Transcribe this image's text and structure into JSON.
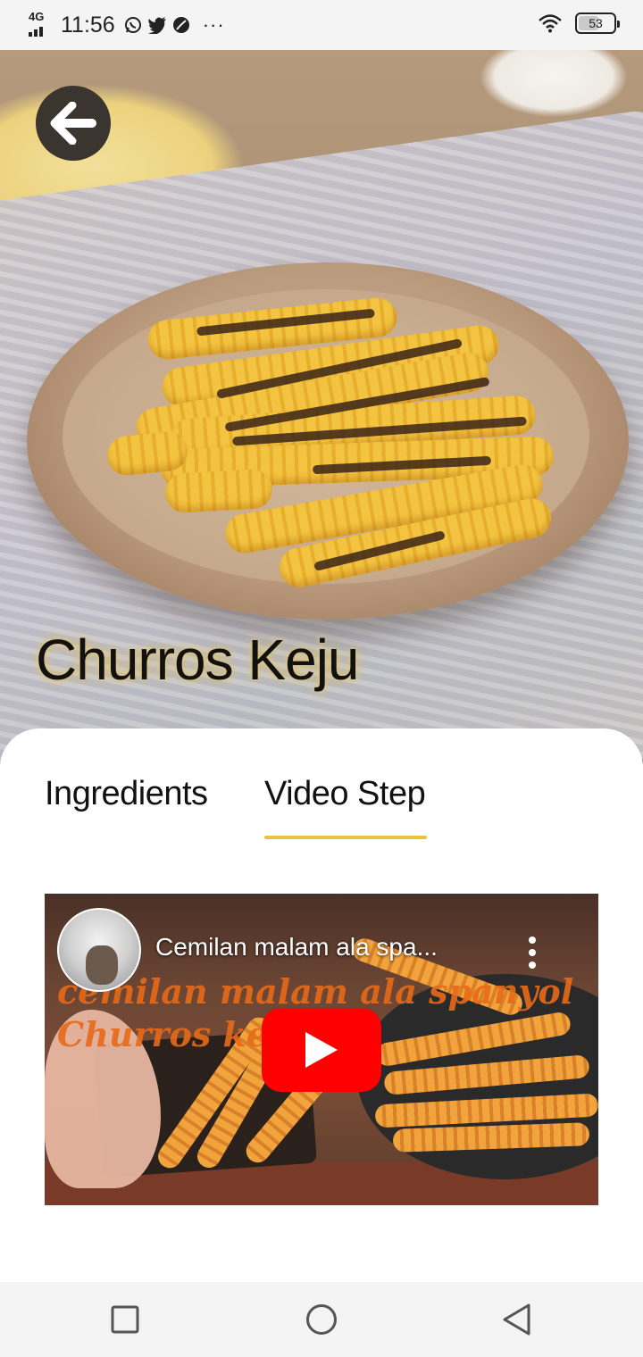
{
  "status_bar": {
    "network": "4G",
    "time": "11:56",
    "overflow": "···",
    "battery_level": "53",
    "icons": [
      "whatsapp-icon",
      "twitter-icon",
      "app-icon",
      "wifi-icon",
      "battery-icon"
    ]
  },
  "recipe": {
    "title": "Churros Keju"
  },
  "tabs": [
    {
      "label": "Ingredients",
      "selected": false
    },
    {
      "label": "Video Step",
      "selected": true
    }
  ],
  "video": {
    "title": "Cemilan malam ala spa...",
    "overlay_line1": "cemilan malam ala spanyol",
    "overlay_line2": "Churros ke"
  },
  "colors": {
    "accent": "#e8c43a",
    "play_button": "#ff0000"
  }
}
